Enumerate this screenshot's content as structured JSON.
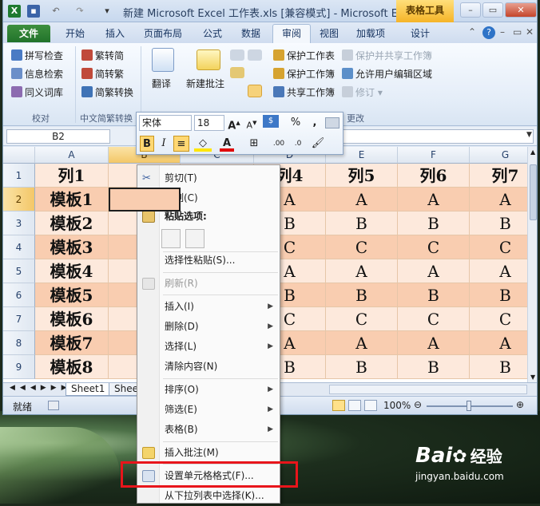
{
  "window": {
    "title": "新建 Microsoft Excel 工作表.xls  [兼容模式] - Microsoft E...",
    "context_tools_label": "表格工具"
  },
  "tabs": [
    "文件",
    "开始",
    "插入",
    "页面布局",
    "公式",
    "数据",
    "审阅",
    "视图",
    "加载项",
    "设计"
  ],
  "ribbon": {
    "proofing": {
      "items": [
        "拼写检查",
        "信息检索",
        "同义词库"
      ],
      "label": "校对"
    },
    "chinese_conv": {
      "items": [
        "繁转简",
        "简转繁",
        "简繁转换"
      ],
      "label": "中文简繁转换"
    },
    "translate_label": "翻译",
    "new_comment_label": "新建批注",
    "protect": {
      "protect_sheet": "保护工作表",
      "protect_workbook": "保护工作簿",
      "share_workbook": "共享工作簿",
      "protect_share": "保护并共享工作簿",
      "allow_edit": "允许用户编辑区域",
      "track_changes": "修订",
      "label": "更改"
    }
  },
  "formula_bar": {
    "name_box": "B2"
  },
  "mini_toolbar": {
    "font": "宋体",
    "size": "18",
    "percent": "%",
    "comma": ","
  },
  "grid": {
    "columns": [
      "A",
      "B",
      "C",
      "D",
      "E",
      "F",
      "G"
    ],
    "rows": [
      "1",
      "2",
      "3",
      "4",
      "5",
      "6",
      "7",
      "8",
      "9"
    ],
    "header_row": [
      "列1",
      "列",
      "",
      "列4",
      "列5",
      "列6",
      "列7"
    ],
    "body": [
      [
        "模板1",
        "",
        "",
        "A",
        "A",
        "A",
        "A"
      ],
      [
        "模板2",
        "",
        "",
        "B",
        "B",
        "B",
        "B"
      ],
      [
        "模板3",
        "",
        "",
        "C",
        "C",
        "C",
        "C"
      ],
      [
        "模板4",
        "",
        "",
        "A",
        "A",
        "A",
        "A"
      ],
      [
        "模板5",
        "",
        "",
        "B",
        "B",
        "B",
        "B"
      ],
      [
        "模板6",
        "",
        "",
        "C",
        "C",
        "C",
        "C"
      ],
      [
        "模板7",
        "",
        "",
        "A",
        "A",
        "A",
        "A"
      ],
      [
        "模板8",
        "",
        "",
        "B",
        "B",
        "B",
        "B"
      ]
    ]
  },
  "sheets": [
    "Sheet1",
    "Sheet"
  ],
  "status": {
    "ready": "就绪",
    "zoom": "100%"
  },
  "context_menu": {
    "items": [
      {
        "label": "剪切(T)"
      },
      {
        "label": "复制(C)"
      },
      {
        "label": "粘贴选项:"
      },
      {
        "label": "选择性粘贴(S)..."
      },
      {
        "label": "刷新(R)"
      },
      {
        "label": "插入(I)"
      },
      {
        "label": "删除(D)"
      },
      {
        "label": "选择(L)"
      },
      {
        "label": "清除内容(N)"
      },
      {
        "label": "排序(O)"
      },
      {
        "label": "筛选(E)"
      },
      {
        "label": "表格(B)"
      },
      {
        "label": "插入批注(M)"
      },
      {
        "label": "设置单元格格式(F)..."
      },
      {
        "label": "从下拉列表中选择(K)..."
      }
    ]
  },
  "watermark": {
    "brand": "Bai",
    "brand2": "经验",
    "url": "jingyan.baidu.com"
  },
  "colors": {
    "header_fill": "#f9cdb0",
    "band_light": "#fde9dc",
    "band_dark": "#f9cdb0",
    "file_tab": "#2a7d31",
    "highlight": "#e8151b"
  }
}
